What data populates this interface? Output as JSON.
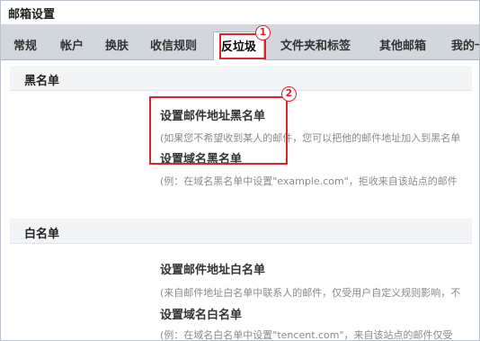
{
  "window": {
    "title": "邮箱设置"
  },
  "tabs": [
    {
      "label": "常规"
    },
    {
      "label": "帐户"
    },
    {
      "label": "换肤"
    },
    {
      "label": "收信规则"
    },
    {
      "label": "反垃圾"
    },
    {
      "label": "文件夹和标签"
    },
    {
      "label": "其他邮箱"
    },
    {
      "label": "我的卡"
    }
  ],
  "blacklist": {
    "header": "黑名单",
    "address_link": "设置邮件地址黑名单",
    "address_desc": "(如果您不希望收到某人的邮件，您可以把他的邮件地址加入到黑名单",
    "domain_link": "设置域名黑名单",
    "domain_desc": "(例：在域名黑名单中设置\"example.com\"，拒收来自该站点的邮件"
  },
  "whitelist": {
    "header": "白名单",
    "address_link": "设置邮件地址白名单",
    "address_desc": "(来自邮件地址白名单中联系人的邮件，仅受用户自定义规则影响，不",
    "domain_link": "设置域名白名单",
    "domain_desc": "(例：在域名白名单中设置\"tencent.com\"，来自该站点的邮件仅受"
  },
  "annotations": {
    "badge1": "1",
    "badge2": "2"
  },
  "colors": {
    "tab_bar": "#d2d7de",
    "annotation": "#d9242e",
    "section_header": "#f3f4f6"
  }
}
